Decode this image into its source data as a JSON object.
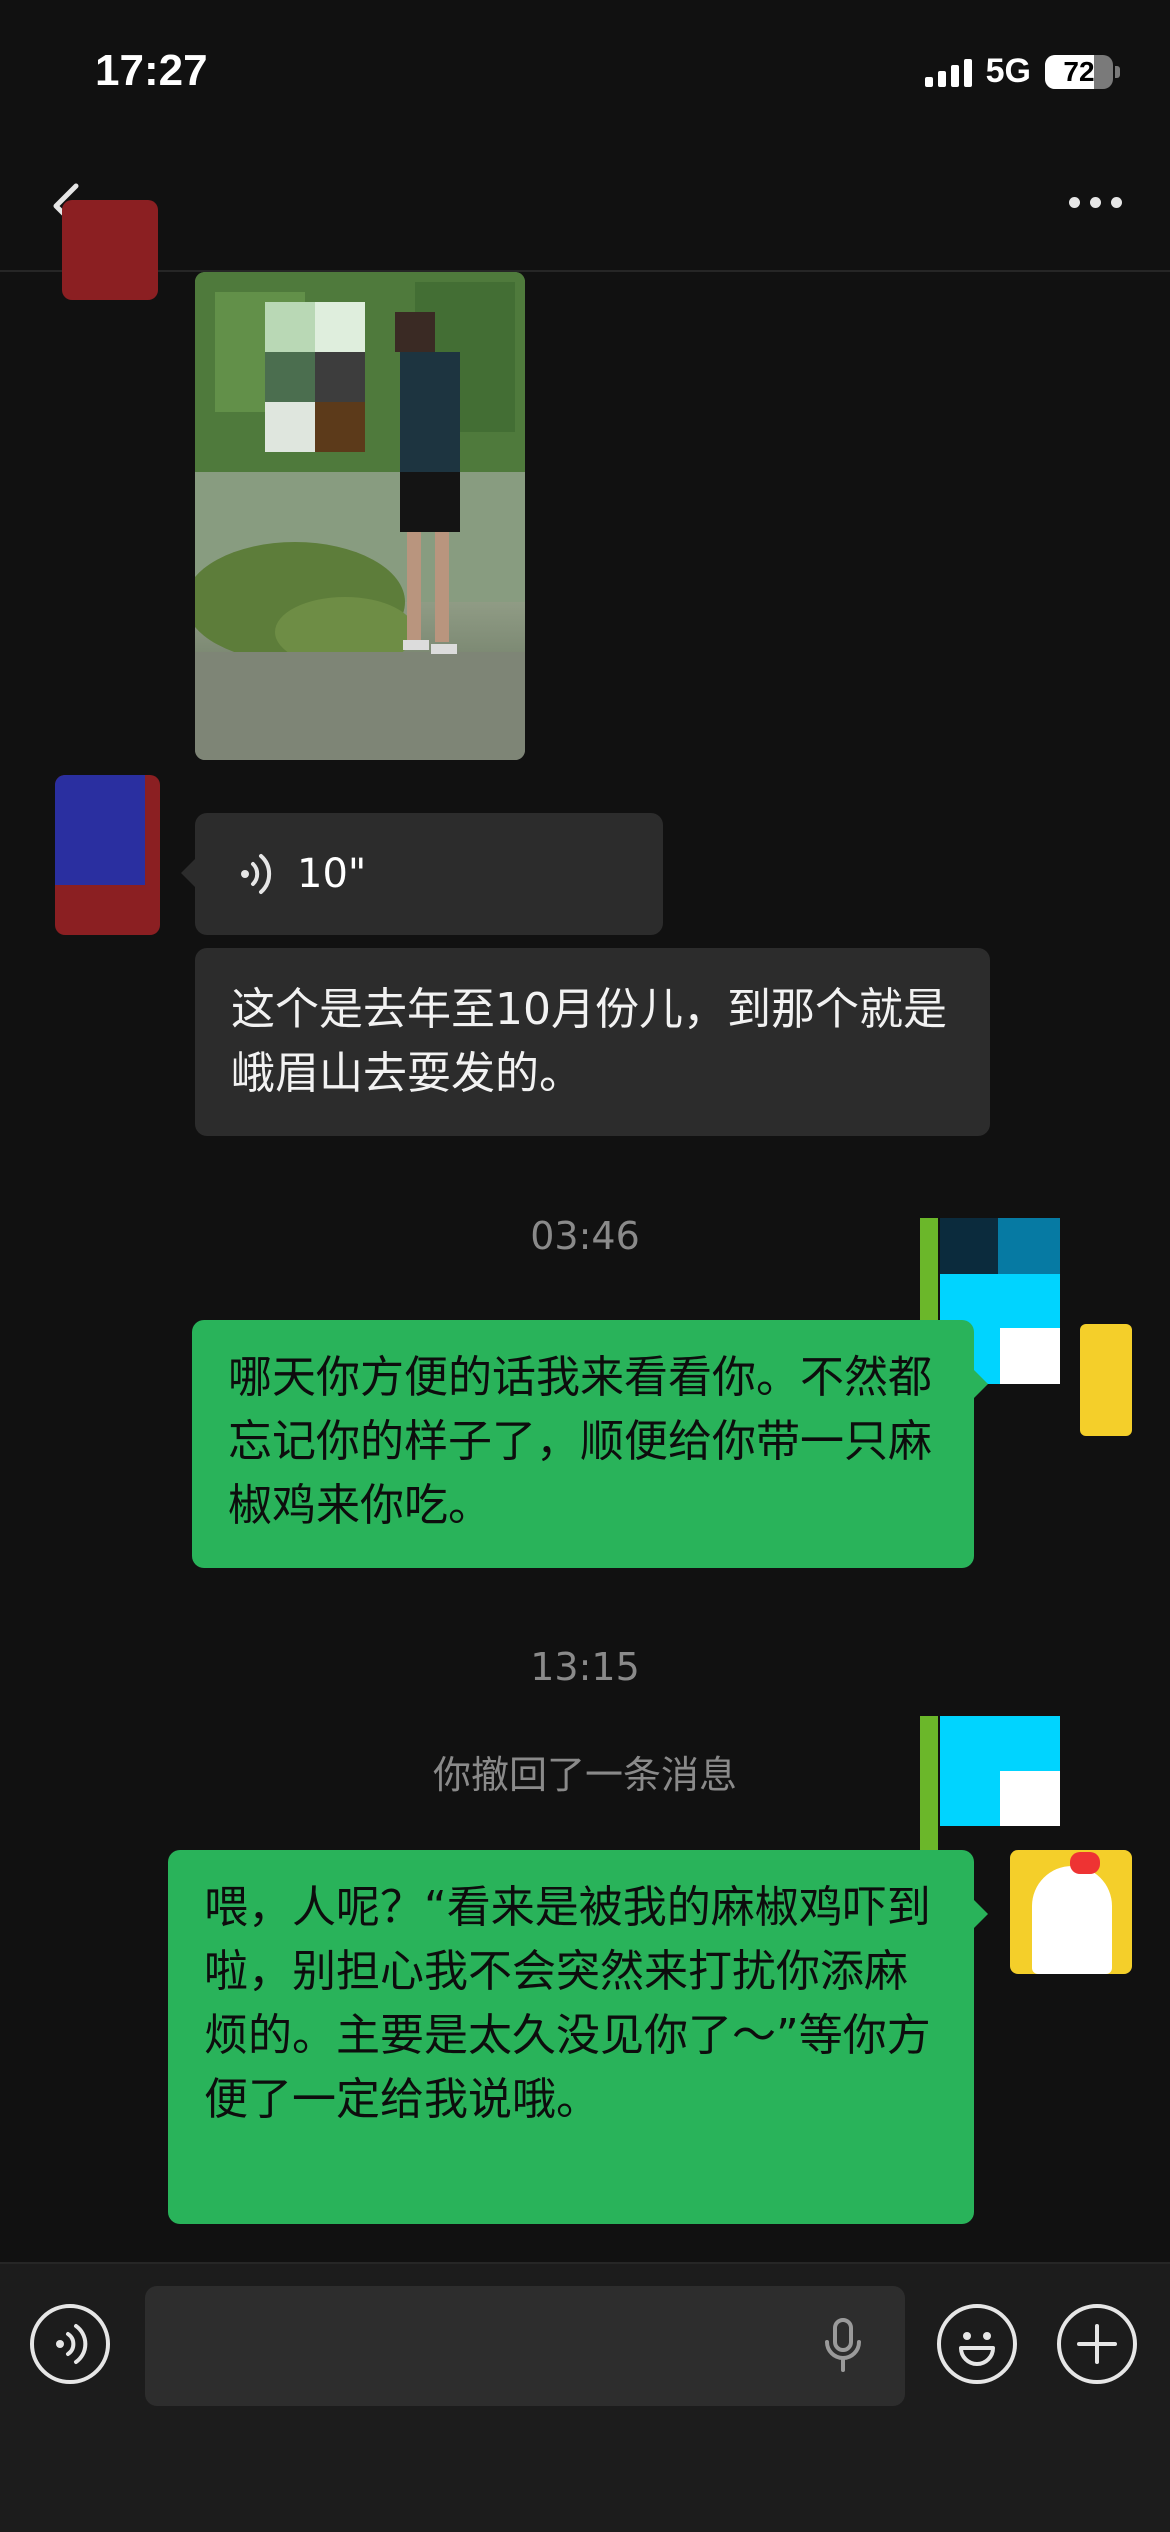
{
  "status_bar": {
    "time": "17:27",
    "network": "5G",
    "battery": "72",
    "battery_level_percent": 72
  },
  "nav": {
    "back_icon": "chevron-left-icon",
    "more_icon": "ellipsis-icon"
  },
  "messages": {
    "voice_duration": "10\"",
    "left_text": "这个是去年至10月份儿，到那个就是峨眉山去耍发的。",
    "time_1": "03:46",
    "right_text_1": "哪天你方便的话我来看看你。不然都忘记你的样子了，顺便给你带一只麻椒鸡来你吃。",
    "time_2": "13:15",
    "recall_notice": "你撤回了一条消息",
    "right_text_2": "喂，人呢？“看来是被我的麻椒鸡吓到啦，别担心我不会突然来打扰你添麻烦的。主要是太久没见你了～”等你方便了一定给我说哦。"
  },
  "input_bar": {
    "voice_icon": "voice-mode-icon",
    "mic_icon": "microphone-icon",
    "emoji_icon": "emoji-icon",
    "plus_icon": "plus-icon"
  },
  "colors": {
    "background": "#111111",
    "bubble_self": "#29b35a",
    "bubble_other": "#2c2c2c",
    "muted_text": "#8a8a8a"
  }
}
